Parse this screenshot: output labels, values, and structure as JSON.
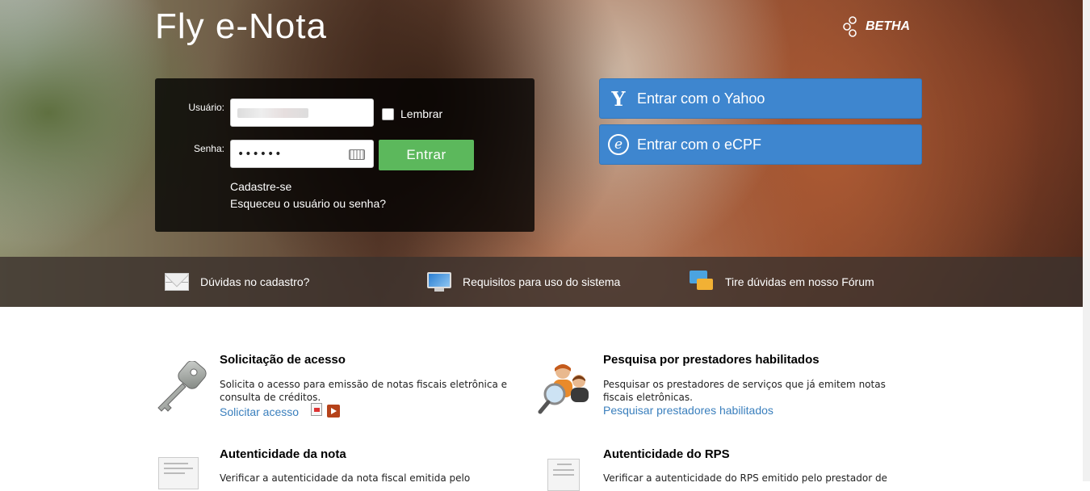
{
  "header": {
    "brand_title": "Fly e-Nota",
    "vendor_logo": "BETHA"
  },
  "login": {
    "user_label": "Usuário:",
    "password_label": "Senha:",
    "password_mask": "••••••",
    "remember_label": "Lembrar",
    "submit_label": "Entrar",
    "register_link": "Cadastre-se",
    "forgot_link": "Esqueceu o usuário ou senha?"
  },
  "external_logins": [
    {
      "label": "Entrar com o Yahoo",
      "icon": "yahoo-icon"
    },
    {
      "label": "Entrar com o eCPF",
      "icon": "ecpf-icon"
    }
  ],
  "info_bar": [
    {
      "label": "Dúvidas no cadastro?",
      "icon": "envelope-icon"
    },
    {
      "label": "Requisitos para uso do sistema",
      "icon": "monitor-icon"
    },
    {
      "label": "Tire dúvidas em nosso Fórum",
      "icon": "forum-icon"
    }
  ],
  "sections": [
    {
      "title": "Solicitação de acesso",
      "text": "Solicita o acesso para emissão de notas fiscais eletrônica e consulta de créditos.",
      "link": "Solicitar acesso",
      "icon": "key-icon"
    },
    {
      "title": "Pesquisa por prestadores habilitados",
      "text": "Pesquisar os prestadores de serviços que já emitem notas fiscais eletrônicas.",
      "link": "Pesquisar prestadores habilitados",
      "icon": "search-people-icon"
    },
    {
      "title": "Autenticidade da nota",
      "text": "Verificar a autenticidade da nota fiscal emitida pelo",
      "icon": "invoice-icon"
    },
    {
      "title": "Autenticidade do RPS",
      "text": "Verificar a autenticidade do RPS emitido pelo prestador de",
      "icon": "receipt-icon"
    }
  ],
  "colors": {
    "primary_blue": "#3e86cf",
    "success_green": "#5cb85c",
    "link_blue": "#3a7fbd"
  }
}
